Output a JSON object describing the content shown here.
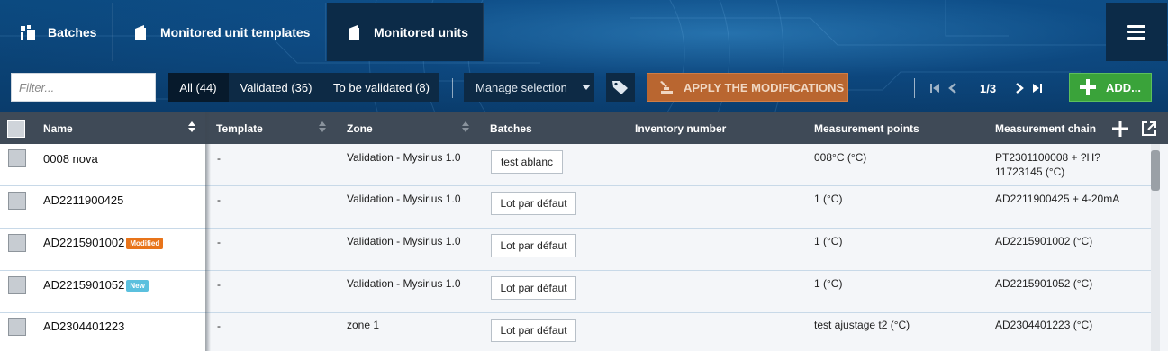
{
  "tabs": [
    {
      "label": "Batches",
      "icon": "batches-icon",
      "active": false
    },
    {
      "label": "Monitored unit templates",
      "icon": "template-icon",
      "active": false
    },
    {
      "label": "Monitored units",
      "icon": "unit-icon",
      "active": true
    }
  ],
  "toolbar": {
    "filter_placeholder": "Filter...",
    "filters": [
      {
        "label": "All (44)",
        "active": true
      },
      {
        "label": "Validated (36)",
        "active": false
      },
      {
        "label": "To be validated (8)",
        "active": false
      }
    ],
    "manage_selection": "Manage selection",
    "apply_label": "APPLY THE MODIFICATIONS",
    "pagination": "1/3",
    "add_label": "ADD..."
  },
  "table": {
    "columns": [
      "Name",
      "Template",
      "Zone",
      "Batches",
      "Inventory number",
      "Measurement points",
      "Measurement chain"
    ],
    "rows": [
      {
        "name": "0008 nova",
        "badge": "",
        "template": "-",
        "zone": "Validation - Mysirius 1.0",
        "batch": "test ablanc",
        "inventory": "",
        "points": "008°C (°C)",
        "chain": "PT2301100008 + ?H?11723145 (°C)"
      },
      {
        "name": "AD2211900425",
        "badge": "",
        "template": "-",
        "zone": "Validation - Mysirius 1.0",
        "batch": "Lot par défaut",
        "inventory": "",
        "points": "1 (°C)",
        "chain": "AD2211900425 + 4-20mA"
      },
      {
        "name": "AD2215901002",
        "badge": "Modified",
        "template": "-",
        "zone": "Validation - Mysirius 1.0",
        "batch": "Lot par défaut",
        "inventory": "",
        "points": "1 (°C)",
        "chain": "AD2215901002 (°C)"
      },
      {
        "name": "AD2215901052",
        "badge": "New",
        "template": "-",
        "zone": "Validation - Mysirius 1.0",
        "batch": "Lot par défaut",
        "inventory": "",
        "points": "1 (°C)",
        "chain": "AD2215901052 (°C)"
      },
      {
        "name": "AD2304401223",
        "badge": "",
        "template": "-",
        "zone": "zone 1",
        "batch": "Lot par défaut",
        "inventory": "",
        "points": "test ajustage t2 (°C)",
        "chain": "AD2304401223 (°C)"
      }
    ]
  },
  "colors": {
    "accent_orange": "#b96630",
    "add_green": "#3aa33a",
    "header_dark": "#3f4a57"
  }
}
